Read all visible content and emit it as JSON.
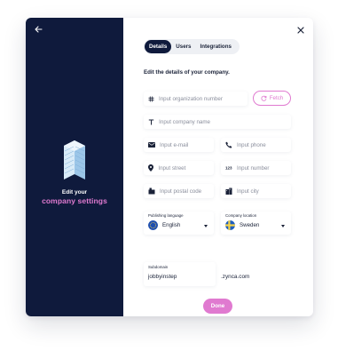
{
  "sidebar": {
    "heading_line1": "Edit your",
    "heading_line2": "company settings"
  },
  "tabs": [
    {
      "label": "Details",
      "active": true
    },
    {
      "label": "Users",
      "active": false
    },
    {
      "label": "Integrations",
      "active": false
    }
  ],
  "form": {
    "subtitle": "Edit the details of your company.",
    "org_number": {
      "placeholder": "Input organization number",
      "value": ""
    },
    "fetch_label": "Fetch",
    "company_name": {
      "placeholder": "Input company name",
      "value": ""
    },
    "email": {
      "placeholder": "Input e-mail",
      "value": ""
    },
    "phone": {
      "placeholder": "Input phone",
      "value": ""
    },
    "street": {
      "placeholder": "Input street",
      "value": ""
    },
    "number": {
      "placeholder": "Input number",
      "value": ""
    },
    "postal_code": {
      "placeholder": "Input postal code",
      "value": ""
    },
    "city": {
      "placeholder": "Input city",
      "value": ""
    },
    "publishing_language": {
      "caption": "Publishing language",
      "value": "English"
    },
    "company_location": {
      "caption": "Company location",
      "value": "Sweden"
    },
    "subdomain": {
      "caption": "Subdomain",
      "value": "jobbyinstep"
    },
    "domain_suffix": ".zynca.com",
    "done_label": "Done"
  },
  "colors": {
    "sidebar_bg": "#0f1a3c",
    "accent_pink": "#e07ad0",
    "text_dark": "#1a2238"
  },
  "icons": {
    "back": "arrow-left-icon",
    "close": "close-icon",
    "org_number": "hash-icon",
    "company_name": "text-icon",
    "email": "mail-icon",
    "phone": "phone-icon",
    "street": "location-pin-icon",
    "number": "dots-icon",
    "postal_code": "mailbox-icon",
    "city": "city-icon",
    "fetch": "refresh-icon",
    "building": "building-icon"
  }
}
